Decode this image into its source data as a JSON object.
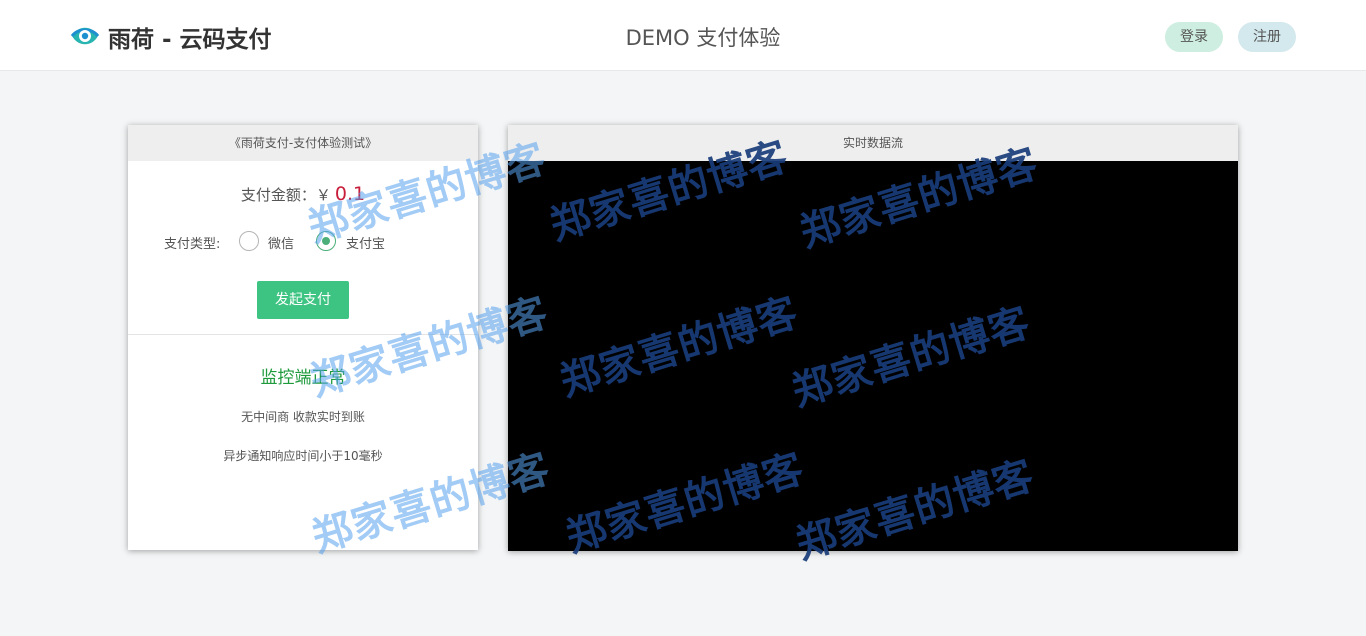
{
  "header": {
    "logo_text": "雨荷 - 云码支付",
    "title": "DEMO 支付体验",
    "login_label": "登录",
    "register_label": "注册"
  },
  "pay_card": {
    "title": "《雨荷支付-支付体验测试》",
    "amount_label": "支付金额：￥",
    "amount_value": "0.1",
    "type_label": "支付类型:",
    "options": [
      {
        "label": "微信",
        "checked": false
      },
      {
        "label": "支付宝",
        "checked": true
      }
    ],
    "submit_label": "发起支付",
    "monitor_status": "监控端正常",
    "features": [
      "无中间商 收款实时到账",
      "异步通知响应时间小于10毫秒"
    ]
  },
  "stream_card": {
    "title": "实时数据流"
  },
  "watermark": {
    "text": "郑家喜的博客"
  },
  "colors": {
    "accent_green": "#3ec482",
    "amount_red": "#c81d3b",
    "status_green": "#1e9a3c",
    "login_bg": "#cdeee0",
    "register_bg": "#d3e9ed"
  },
  "icons": {
    "logo": "eye-logo-icon"
  }
}
